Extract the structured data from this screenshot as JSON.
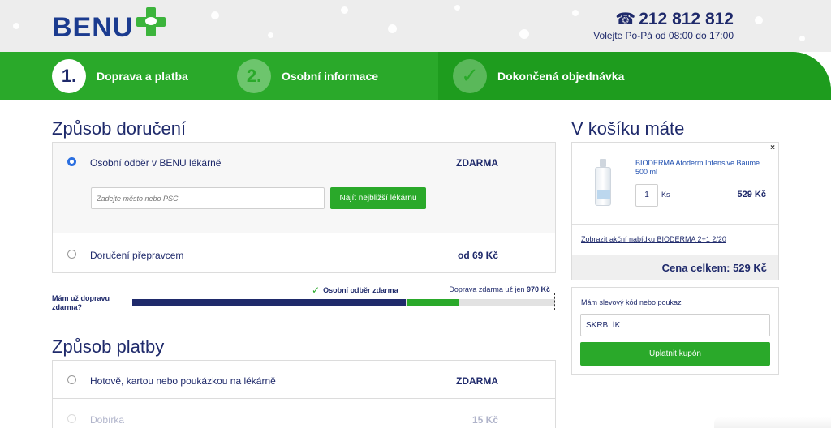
{
  "header": {
    "logo_text": "BENU",
    "phone_number": "212 812 812",
    "phone_hours": "Volejte Po-Pá od 08:00 do 17:00"
  },
  "steps": [
    {
      "number": "1.",
      "label": "Doprava a platba",
      "state": "active"
    },
    {
      "number": "2.",
      "label": "Osobní informace",
      "state": "upcoming"
    },
    {
      "number": "✓",
      "label": "Dokončená objednávka",
      "state": "upcoming"
    }
  ],
  "delivery": {
    "title": "Způsob doručení",
    "options": [
      {
        "label": "Osobní odběr v BENU lékárně",
        "price": "ZDARMA",
        "selected": true
      },
      {
        "label": "Doručení přepravcem",
        "price": "od 69 Kč",
        "selected": false
      }
    ],
    "city_placeholder": "Zadejte město nebo PSČ",
    "find_button": "Najít nejbližší lékárnu"
  },
  "shipping_progress": {
    "label": "Mám už dopravu zdarma?",
    "pickup_label": "Osobní odběr zdarma",
    "free_prefix": "Doprava zdarma už jen",
    "free_amount": "970 Kč"
  },
  "payment": {
    "title": "Způsob platby",
    "options": [
      {
        "label": "Hotově, kartou nebo poukázkou na lékárně",
        "price": "ZDARMA",
        "selected": false
      },
      {
        "label": "Dobírka",
        "price": "15 Kč",
        "selected": false
      }
    ]
  },
  "cart": {
    "title": "V košíku máte",
    "close_label": "×",
    "item": {
      "name": "BIODERMA Atoderm Intensive Baume 500 ml",
      "quantity": "1",
      "unit": "Ks",
      "price": "529 Kč"
    },
    "promo_link": "Zobrazit akční nabídku BIODERMA 2+1 2/20",
    "total": "Cena celkem: 529 Kč"
  },
  "coupon": {
    "label": "Mám slevový kód nebo poukaz",
    "value": "SKRBLÍK",
    "button": "Uplatnit kupón"
  },
  "colors": {
    "brand_green": "#2aa92a",
    "brand_navy": "#1f2a6b",
    "radio_blue": "#2b6fe0"
  }
}
